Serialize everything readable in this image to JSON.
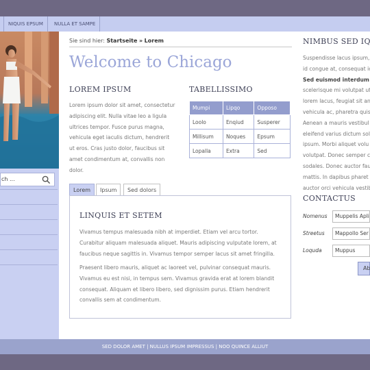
{
  "nav": {
    "items": [
      "Niquis epsum",
      "Nulla et sampe"
    ]
  },
  "sidebar": {
    "search_placeholder": "ch ..."
  },
  "main": {
    "breadcrumb_prefix": "Sie sind hier:",
    "breadcrumb_home": "Startseite",
    "breadcrumb_sep": "»",
    "breadcrumb_current": "Lorem",
    "title": "Welcome to Chicago",
    "lorem_heading": "LOREM IPSUM",
    "lorem_text": "Lorem ipsum dolor sit amet, consectetur adipiscing elit. Nulla vitae leo a ligula ultrices tempor. Fusce purus magna, vehicula eget iaculis dictum, hendrerit ut eros. Cras justo dolor, faucibus sit amet condimentum at, convallis non dolor.",
    "table_heading": "TABELLISSIMO",
    "table": {
      "headers": [
        "Mumpi",
        "Lipqo",
        "Opposo"
      ],
      "rows": [
        [
          "Loolo",
          "Enqiud",
          "Susperer"
        ],
        [
          "Millisum",
          "Noques",
          "Epsum"
        ],
        [
          "Lopalla",
          "Extra",
          "Sed"
        ]
      ]
    },
    "tabs": [
      "Lorem",
      "Ipsum",
      "Sed dolors"
    ],
    "panel_heading": "LINQUIS ET SETEM",
    "panel_p1": "Vivamus tempus malesuada nibh at imperdiet. Etiam vel arcu tortor. Curabitur aliquam malesuada aliquet. Mauris adipiscing vulputate lorem, at faucibus neque sagittis in. Vivamus tempor semper lacus sit amet fringilla.",
    "panel_p2": "Praesent libero mauris, aliquet ac laoreet vel, pulvinar consequat mauris. Vivamus eu est nisi, in tempus sem. Vivamus gravida erat at lorem blandit consequat. Aliquam et libero libero, sed dignissim purus. Etiam hendrerit convallis sem at condimentum."
  },
  "right": {
    "heading": "NIMBUS SED IQU",
    "lines": [
      "Suspendisse lacus ipsum,",
      "id congue at, consequat ic",
      "Sed euismod interdum s",
      "scelerisque mi volutpat ut",
      "lorem lacus, feugiat sit an",
      "vehicula ac, pharetra quis",
      "Aenean a mauris vestibul",
      "eleifend varius dictum sol",
      "ipsum. Morbi aliquet volu",
      "volutpat. Donec semper c",
      "sodales. Donec auctor fau",
      "mattis. In dapibus pharet",
      "auctor orci vehicula vestib"
    ],
    "contact_heading": "CONTACTUS",
    "fields": [
      {
        "label": "Nomenus",
        "value": "Muppelis Apli"
      },
      {
        "label": "Streetus",
        "value": "Mappollo Ser"
      },
      {
        "label": "Loquda",
        "value": "Muppus"
      }
    ],
    "button_label": "Ab"
  },
  "footer": {
    "text": "Sed dolor amet | Nullus ipsum impressus | Noo quince alliut"
  }
}
